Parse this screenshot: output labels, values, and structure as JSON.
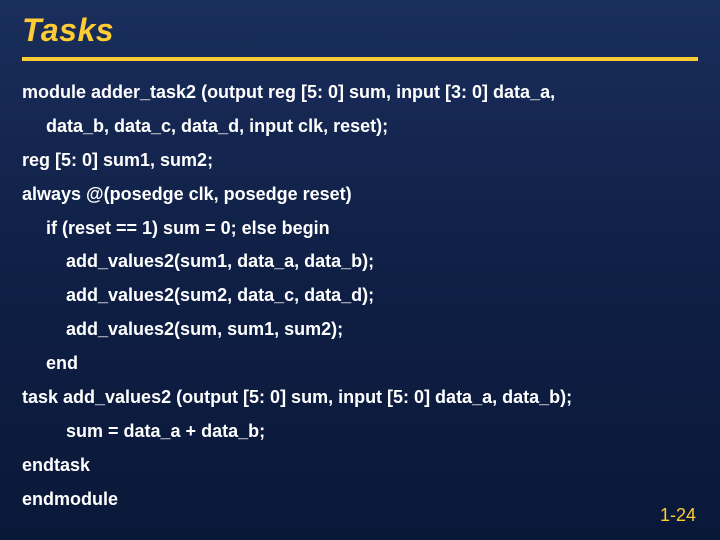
{
  "title": "Tasks",
  "code": {
    "l1a": "module adder_task2 (output  reg [5: 0] sum, input [3: 0] data_a,",
    "l1b": "data_b, data_c, data_d, input clk, reset);",
    "l2": "reg [5: 0] sum1, sum2;",
    "l3": "always @(posedge clk, posedge reset)",
    "l4": "if (reset == 1) sum = 0; else begin",
    "l5": "add_values2(sum1, data_a, data_b);",
    "l6": "add_values2(sum2, data_c, data_d);",
    "l7": "add_values2(sum, sum1, sum2);",
    "l8": "end",
    "l9": "task add_values2 (output [5: 0] sum, input [5: 0] data_a, data_b);",
    "l10": "sum = data_a + data_b;",
    "l11": "endtask",
    "l12": "endmodule"
  },
  "pagenum": "1-24"
}
